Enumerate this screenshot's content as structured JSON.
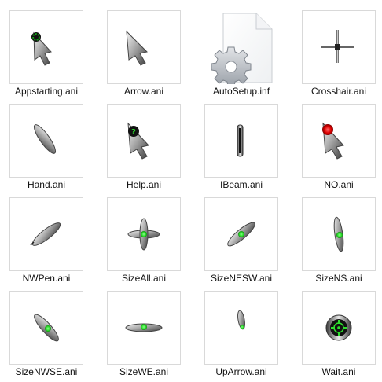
{
  "files": [
    {
      "name": "Appstarting.ani",
      "icon": "appstarting-cursor-icon"
    },
    {
      "name": "Arrow.ani",
      "icon": "arrow-cursor-icon"
    },
    {
      "name": "AutoSetup.inf",
      "icon": "setup-file-gear-icon"
    },
    {
      "name": "Crosshair.ani",
      "icon": "crosshair-cursor-icon"
    },
    {
      "name": "Hand.ani",
      "icon": "hand-cursor-icon"
    },
    {
      "name": "Help.ani",
      "icon": "help-cursor-icon"
    },
    {
      "name": "IBeam.ani",
      "icon": "ibeam-cursor-icon"
    },
    {
      "name": "NO.ani",
      "icon": "no-cursor-icon"
    },
    {
      "name": "NWPen.ani",
      "icon": "pen-cursor-icon"
    },
    {
      "name": "SizeAll.ani",
      "icon": "size-all-cursor-icon"
    },
    {
      "name": "SizeNESW.ani",
      "icon": "size-nesw-cursor-icon"
    },
    {
      "name": "SizeNS.ani",
      "icon": "size-ns-cursor-icon"
    },
    {
      "name": "SizeNWSE.ani",
      "icon": "size-nwse-cursor-icon"
    },
    {
      "name": "SizeWE.ani",
      "icon": "size-we-cursor-icon"
    },
    {
      "name": "UpArrow.ani",
      "icon": "up-arrow-cursor-icon"
    },
    {
      "name": "Wait.ani",
      "icon": "wait-cursor-icon"
    }
  ],
  "colors": {
    "metal_dark": "#555555",
    "metal_light": "#e6e6e6",
    "accent_green": "#2ee02e",
    "accent_red": "#e00000",
    "thumb_border": "#d9d9d9"
  }
}
